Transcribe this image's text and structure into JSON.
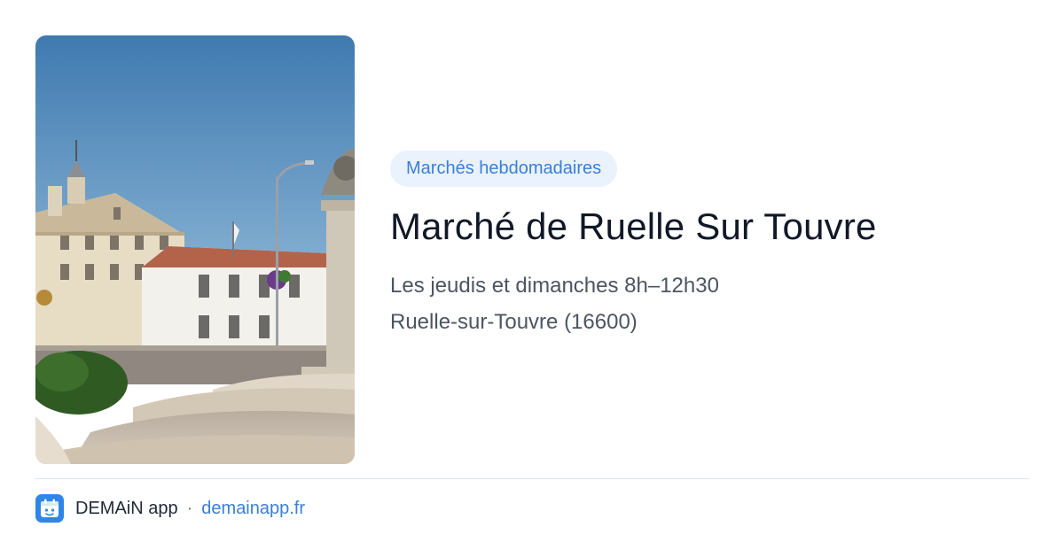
{
  "badge": "Marchés hebdomadaires",
  "title": "Marché de Ruelle Sur Touvre",
  "schedule": "Les jeudis et dimanches 8h–12h30",
  "location": "Ruelle-sur-Touvre (16600)",
  "footer": {
    "app_name": "DEMAiN app",
    "separator": "·",
    "site": "demainapp.fr",
    "app_icon": "calendar-icon"
  },
  "colors": {
    "accent": "#3b7fd6",
    "badge_bg": "#eaf2fd",
    "title": "#111827",
    "body_text": "#4b5563",
    "divider": "#dbe3ea",
    "app_icon_bg": "#2f86e6"
  }
}
